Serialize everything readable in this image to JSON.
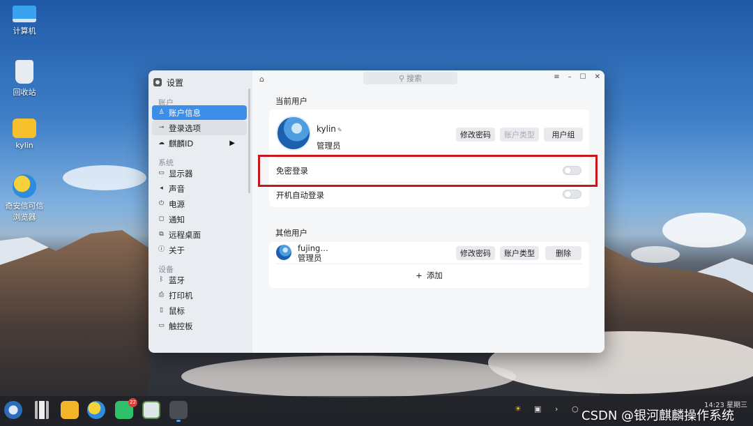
{
  "desktop": {
    "icons": [
      {
        "label": "计算机",
        "icon": "computer-icon"
      },
      {
        "label": "回收站",
        "icon": "trash-icon"
      },
      {
        "label": "kylin",
        "icon": "folder-icon"
      },
      {
        "label": "奇安信可信浏览器",
        "icon": "browser-icon"
      }
    ]
  },
  "window": {
    "title": "设置",
    "search_placeholder": "搜索",
    "controls": [
      "≡",
      "–",
      "☐",
      "✕"
    ]
  },
  "sidebar": {
    "groups": [
      {
        "label": "账户",
        "items": [
          {
            "label": "账户信息",
            "icon": "user-icon",
            "active": true
          },
          {
            "label": "登录选项",
            "icon": "key-icon"
          },
          {
            "label": "麒麟ID",
            "icon": "cloud-icon"
          }
        ]
      },
      {
        "label": "系统",
        "items": [
          {
            "label": "显示器",
            "icon": "monitor-icon"
          },
          {
            "label": "声音",
            "icon": "speaker-icon"
          },
          {
            "label": "电源",
            "icon": "power-icon"
          },
          {
            "label": "通知",
            "icon": "bell-icon"
          },
          {
            "label": "远程桌面",
            "icon": "remote-desktop-icon"
          },
          {
            "label": "关于",
            "icon": "info-icon"
          }
        ]
      },
      {
        "label": "设备",
        "items": [
          {
            "label": "蓝牙",
            "icon": "bluetooth-icon"
          },
          {
            "label": "打印机",
            "icon": "printer-icon"
          },
          {
            "label": "鼠标",
            "icon": "mouse-icon"
          },
          {
            "label": "触控板",
            "icon": "touchpad-icon"
          }
        ]
      }
    ]
  },
  "current_user": {
    "section_title": "当前用户",
    "name": "kylin",
    "role": "管理员",
    "buttons": {
      "change_password": "修改密码",
      "account_type": "账户类型",
      "user_group": "用户组"
    },
    "passwordless_login": {
      "label": "免密登录",
      "enabled": false
    },
    "auto_login": {
      "label": "开机自动登录",
      "enabled": false
    }
  },
  "other_users": {
    "section_title": "其他用户",
    "users": [
      {
        "name": "fujing…",
        "role": "管理员",
        "buttons": {
          "change_password": "修改密码",
          "account_type": "账户类型",
          "delete": "删除"
        }
      }
    ],
    "add_label": "添加"
  },
  "taskbar": {
    "apps": [
      {
        "icon": "start-menu-icon"
      },
      {
        "icon": "multitask-view-icon"
      },
      {
        "icon": "file-manager-icon"
      },
      {
        "icon": "browser-icon"
      },
      {
        "icon": "wechat-icon",
        "badge": "22"
      },
      {
        "icon": "image-viewer-icon"
      },
      {
        "icon": "settings-icon",
        "active": true
      }
    ],
    "clock": "14:23 星期三"
  },
  "watermark": "CSDN @银河麒麟操作系统",
  "colors": {
    "accent": "#3d8ee9",
    "highlight_border": "#c8161d"
  }
}
